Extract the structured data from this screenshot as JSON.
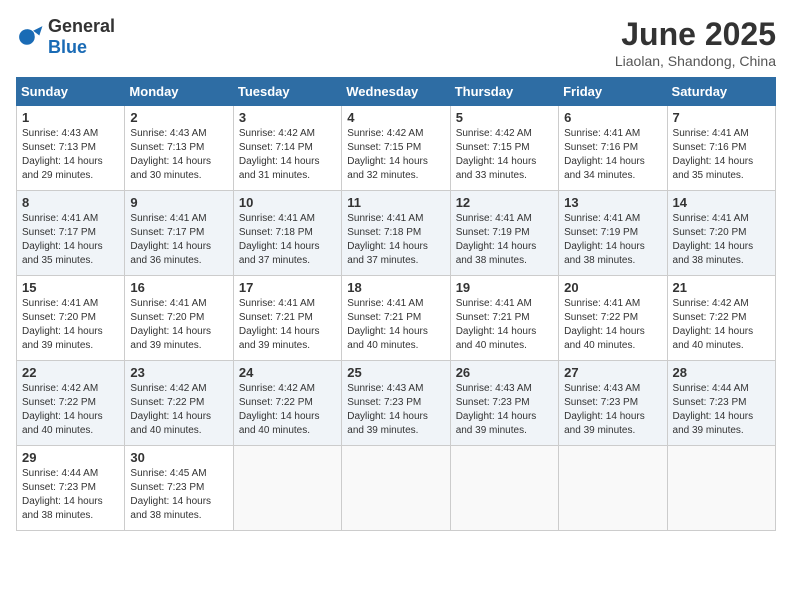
{
  "header": {
    "logo_general": "General",
    "logo_blue": "Blue",
    "title": "June 2025",
    "subtitle": "Liaolan, Shandong, China"
  },
  "columns": [
    "Sunday",
    "Monday",
    "Tuesday",
    "Wednesday",
    "Thursday",
    "Friday",
    "Saturday"
  ],
  "weeks": [
    [
      {
        "day": "1",
        "sunrise": "Sunrise: 4:43 AM",
        "sunset": "Sunset: 7:13 PM",
        "daylight": "Daylight: 14 hours and 29 minutes."
      },
      {
        "day": "2",
        "sunrise": "Sunrise: 4:43 AM",
        "sunset": "Sunset: 7:13 PM",
        "daylight": "Daylight: 14 hours and 30 minutes."
      },
      {
        "day": "3",
        "sunrise": "Sunrise: 4:42 AM",
        "sunset": "Sunset: 7:14 PM",
        "daylight": "Daylight: 14 hours and 31 minutes."
      },
      {
        "day": "4",
        "sunrise": "Sunrise: 4:42 AM",
        "sunset": "Sunset: 7:15 PM",
        "daylight": "Daylight: 14 hours and 32 minutes."
      },
      {
        "day": "5",
        "sunrise": "Sunrise: 4:42 AM",
        "sunset": "Sunset: 7:15 PM",
        "daylight": "Daylight: 14 hours and 33 minutes."
      },
      {
        "day": "6",
        "sunrise": "Sunrise: 4:41 AM",
        "sunset": "Sunset: 7:16 PM",
        "daylight": "Daylight: 14 hours and 34 minutes."
      },
      {
        "day": "7",
        "sunrise": "Sunrise: 4:41 AM",
        "sunset": "Sunset: 7:16 PM",
        "daylight": "Daylight: 14 hours and 35 minutes."
      }
    ],
    [
      {
        "day": "8",
        "sunrise": "Sunrise: 4:41 AM",
        "sunset": "Sunset: 7:17 PM",
        "daylight": "Daylight: 14 hours and 35 minutes."
      },
      {
        "day": "9",
        "sunrise": "Sunrise: 4:41 AM",
        "sunset": "Sunset: 7:17 PM",
        "daylight": "Daylight: 14 hours and 36 minutes."
      },
      {
        "day": "10",
        "sunrise": "Sunrise: 4:41 AM",
        "sunset": "Sunset: 7:18 PM",
        "daylight": "Daylight: 14 hours and 37 minutes."
      },
      {
        "day": "11",
        "sunrise": "Sunrise: 4:41 AM",
        "sunset": "Sunset: 7:18 PM",
        "daylight": "Daylight: 14 hours and 37 minutes."
      },
      {
        "day": "12",
        "sunrise": "Sunrise: 4:41 AM",
        "sunset": "Sunset: 7:19 PM",
        "daylight": "Daylight: 14 hours and 38 minutes."
      },
      {
        "day": "13",
        "sunrise": "Sunrise: 4:41 AM",
        "sunset": "Sunset: 7:19 PM",
        "daylight": "Daylight: 14 hours and 38 minutes."
      },
      {
        "day": "14",
        "sunrise": "Sunrise: 4:41 AM",
        "sunset": "Sunset: 7:20 PM",
        "daylight": "Daylight: 14 hours and 38 minutes."
      }
    ],
    [
      {
        "day": "15",
        "sunrise": "Sunrise: 4:41 AM",
        "sunset": "Sunset: 7:20 PM",
        "daylight": "Daylight: 14 hours and 39 minutes."
      },
      {
        "day": "16",
        "sunrise": "Sunrise: 4:41 AM",
        "sunset": "Sunset: 7:20 PM",
        "daylight": "Daylight: 14 hours and 39 minutes."
      },
      {
        "day": "17",
        "sunrise": "Sunrise: 4:41 AM",
        "sunset": "Sunset: 7:21 PM",
        "daylight": "Daylight: 14 hours and 39 minutes."
      },
      {
        "day": "18",
        "sunrise": "Sunrise: 4:41 AM",
        "sunset": "Sunset: 7:21 PM",
        "daylight": "Daylight: 14 hours and 40 minutes."
      },
      {
        "day": "19",
        "sunrise": "Sunrise: 4:41 AM",
        "sunset": "Sunset: 7:21 PM",
        "daylight": "Daylight: 14 hours and 40 minutes."
      },
      {
        "day": "20",
        "sunrise": "Sunrise: 4:41 AM",
        "sunset": "Sunset: 7:22 PM",
        "daylight": "Daylight: 14 hours and 40 minutes."
      },
      {
        "day": "21",
        "sunrise": "Sunrise: 4:42 AM",
        "sunset": "Sunset: 7:22 PM",
        "daylight": "Daylight: 14 hours and 40 minutes."
      }
    ],
    [
      {
        "day": "22",
        "sunrise": "Sunrise: 4:42 AM",
        "sunset": "Sunset: 7:22 PM",
        "daylight": "Daylight: 14 hours and 40 minutes."
      },
      {
        "day": "23",
        "sunrise": "Sunrise: 4:42 AM",
        "sunset": "Sunset: 7:22 PM",
        "daylight": "Daylight: 14 hours and 40 minutes."
      },
      {
        "day": "24",
        "sunrise": "Sunrise: 4:42 AM",
        "sunset": "Sunset: 7:22 PM",
        "daylight": "Daylight: 14 hours and 40 minutes."
      },
      {
        "day": "25",
        "sunrise": "Sunrise: 4:43 AM",
        "sunset": "Sunset: 7:23 PM",
        "daylight": "Daylight: 14 hours and 39 minutes."
      },
      {
        "day": "26",
        "sunrise": "Sunrise: 4:43 AM",
        "sunset": "Sunset: 7:23 PM",
        "daylight": "Daylight: 14 hours and 39 minutes."
      },
      {
        "day": "27",
        "sunrise": "Sunrise: 4:43 AM",
        "sunset": "Sunset: 7:23 PM",
        "daylight": "Daylight: 14 hours and 39 minutes."
      },
      {
        "day": "28",
        "sunrise": "Sunrise: 4:44 AM",
        "sunset": "Sunset: 7:23 PM",
        "daylight": "Daylight: 14 hours and 39 minutes."
      }
    ],
    [
      {
        "day": "29",
        "sunrise": "Sunrise: 4:44 AM",
        "sunset": "Sunset: 7:23 PM",
        "daylight": "Daylight: 14 hours and 38 minutes."
      },
      {
        "day": "30",
        "sunrise": "Sunrise: 4:45 AM",
        "sunset": "Sunset: 7:23 PM",
        "daylight": "Daylight: 14 hours and 38 minutes."
      },
      null,
      null,
      null,
      null,
      null
    ]
  ]
}
